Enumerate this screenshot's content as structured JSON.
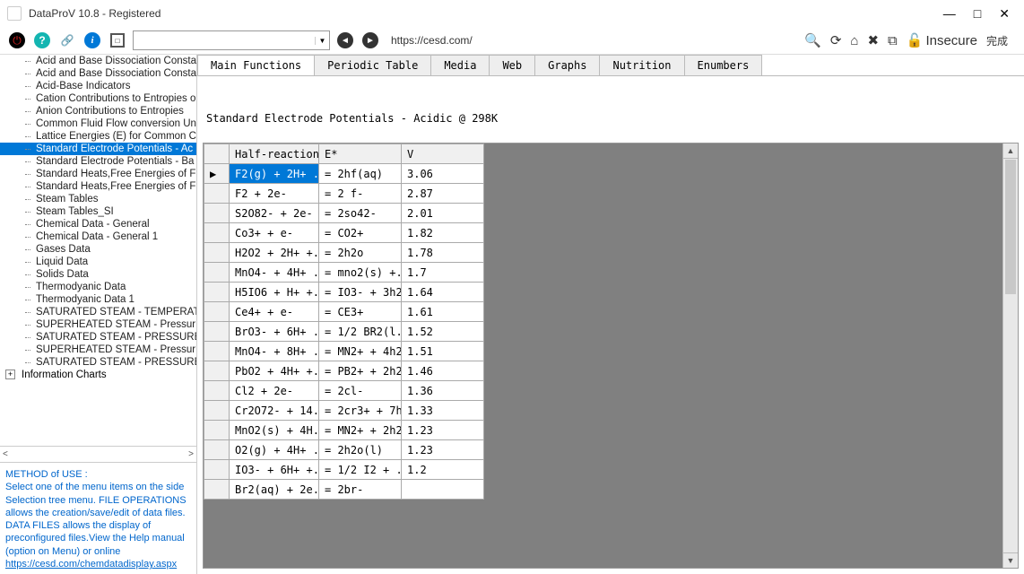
{
  "window": {
    "title": "DataProV 10.8 - Registered"
  },
  "win_controls": {
    "min": "—",
    "max": "□",
    "close": "✕"
  },
  "toolbar": {
    "url_display": "https://cesd.com/",
    "right": {
      "insecure": "Insecure",
      "done": "完成"
    }
  },
  "tree": {
    "items": [
      "Acid and Base Dissociation Consta",
      "Acid and Base Dissociation Consta",
      "Acid-Base Indicators",
      "Cation Contributions to Entropies o",
      "Anion Contributions to Entropies",
      "Common Fluid Flow conversion Un",
      "Lattice Energies (E) for Common C",
      "Standard Electrode Potentials - Ac",
      "Standard Electrode Potentials - Ba",
      "Standard Heats,Free Energies of F",
      "Standard Heats,Free Energies of F",
      "Steam Tables",
      "Steam Tables_SI",
      "Chemical Data - General",
      "Chemical Data - General 1",
      "Gases Data",
      "Liquid Data",
      "Solids Data",
      "Thermodyanic Data",
      "Thermodyanic Data 1",
      "SATURATED STEAM - TEMPERAT",
      "SUPERHEATED STEAM - Pressur",
      "SATURATED STEAM - PRESSURE",
      "SUPERHEATED STEAM - Pressur",
      "SATURATED STEAM - PRESSURE"
    ],
    "selected_index": 7,
    "root2": "Information Charts",
    "scroll": {
      "left": "<",
      "right": ">"
    }
  },
  "help": {
    "title": "METHOD of USE :",
    "body": "Select one of the menu items on the side Selection tree menu. FILE OPERATIONS allows the creation/save/edit of data files. DATA FILES allows the display of preconfigured files.View the Help manual (option on Menu) or online",
    "link": "https://cesd.com/chemdatadisplay.aspx"
  },
  "tabs": {
    "items": [
      "Main Functions",
      "Periodic Table",
      "Media",
      "Web",
      "Graphs",
      "Nutrition",
      "Enumbers"
    ],
    "active": 0
  },
  "heading": "Standard Electrode Potentials - Acidic @ 298K",
  "grid": {
    "headers": [
      "Half-reaction",
      "E*",
      "V"
    ],
    "row_indicator": "▶",
    "rows": [
      {
        "hr": "F2(g) + 2H+ ...",
        "ee": "= 2hf(aq)",
        "v": "3.06"
      },
      {
        "hr": "F2 + 2e-",
        "ee": "= 2 f-",
        "v": "2.87"
      },
      {
        "hr": "S2O82- + 2e-",
        "ee": "= 2so42-",
        "v": "2.01"
      },
      {
        "hr": "Co3+ + e-",
        "ee": "= CO2+",
        "v": "1.82"
      },
      {
        "hr": "H2O2 + 2H+ +...",
        "ee": "= 2h2o",
        "v": "1.78"
      },
      {
        "hr": "MnO4- + 4H+ ...",
        "ee": "= mno2(s) +...",
        "v": "1.7"
      },
      {
        "hr": "H5IO6 + H+ +...",
        "ee": "= IO3- + 3h2o",
        "v": "1.64"
      },
      {
        "hr": "Ce4+ + e-",
        "ee": "= CE3+",
        "v": "1.61"
      },
      {
        "hr": "BrO3- + 6H+ ...",
        "ee": "= 1/2 BR2(l...",
        "v": "1.52"
      },
      {
        "hr": "MnO4- + 8H+ ...",
        "ee": "= MN2+ + 4h2o",
        "v": "1.51"
      },
      {
        "hr": "PbO2 + 4H+ +...",
        "ee": "= PB2+ + 2h2o",
        "v": "1.46"
      },
      {
        "hr": "Cl2 + 2e-",
        "ee": "= 2cl-",
        "v": "1.36"
      },
      {
        "hr": "Cr2O72- + 14...",
        "ee": "= 2cr3+ + 7h2o",
        "v": "1.33"
      },
      {
        "hr": "MnO2(s) + 4H...",
        "ee": "= MN2+ + 2h2o",
        "v": "1.23"
      },
      {
        "hr": "O2(g) + 4H+ ...",
        "ee": "= 2h2o(l)",
        "v": "1.23"
      },
      {
        "hr": "IO3- + 6H+ +...",
        "ee": "= 1/2 I2 + ...",
        "v": "1.2"
      },
      {
        "hr": "Br2(aq) + 2e...",
        "ee": "= 2br-",
        "v": ""
      }
    ]
  }
}
